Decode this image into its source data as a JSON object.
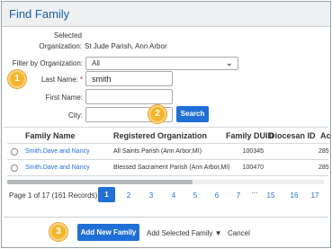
{
  "dialog": {
    "title": "Find Family"
  },
  "form": {
    "selected_label": "Selected",
    "organization_label": "Organization:",
    "organization_value": "St Jude Parish, Ann Arbor",
    "filter_label": "Filter by Organization:",
    "filter_value": "All",
    "last_name_label": "Last Name:",
    "last_name_required": "*",
    "last_name_value": "smith",
    "first_name_label": "First Name:",
    "first_name_value": "",
    "city_label": "City:",
    "city_value": "",
    "search_label": "Search"
  },
  "callouts": {
    "one": "1",
    "two": "2",
    "three": "3"
  },
  "table": {
    "columns": [
      "Family Name",
      "Registered Organization",
      "Family DUID",
      "Diocesan ID",
      "Ac"
    ],
    "rows": [
      {
        "family_name": "Smith,Dave and Nancy",
        "organization": "All Saints Parish (Ann Arbor,MI)",
        "duid": "100345",
        "diocesan_id": "",
        "extra": "285"
      },
      {
        "family_name": "Smith,Dave and Nancy",
        "organization": "Blessed Sacrament Parish (Ann Arbor,MI)",
        "duid": "100470",
        "diocesan_id": "",
        "extra": "285"
      }
    ]
  },
  "pager": {
    "info": "Page 1 of 17 (161 Records)",
    "prev": "<",
    "pages": [
      "1",
      "2",
      "3",
      "4",
      "5",
      "6",
      "7",
      "...",
      "15",
      "16",
      "17"
    ],
    "current": "1"
  },
  "footer": {
    "add_new_family": "Add New Family",
    "add_selected_family": "Add Selected Family ▼",
    "cancel": "Cancel"
  },
  "colors": {
    "accent": "#1f6fd6",
    "callout": "#f4b62c",
    "title": "#1b5fa8"
  }
}
